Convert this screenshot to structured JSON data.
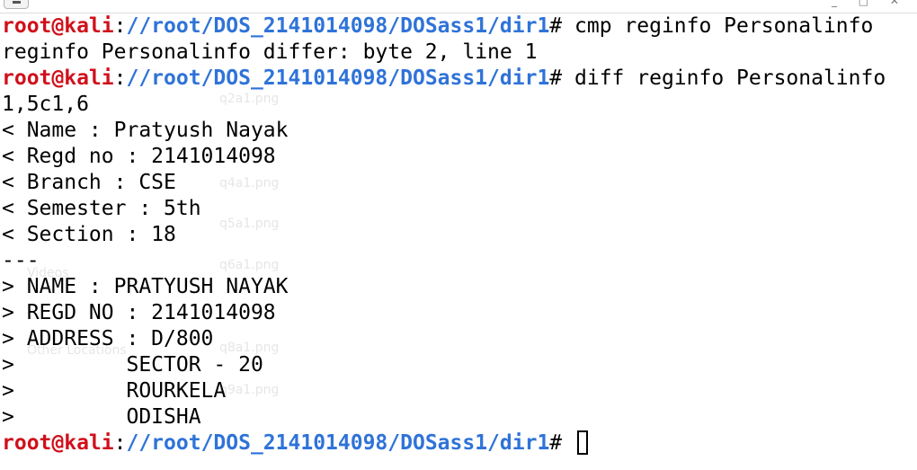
{
  "terminal": {
    "prompt": {
      "user": "root@kali",
      "separator": ":",
      "path": "//root/DOS_2141014098/DOSass1/dir1",
      "symbol": "#"
    },
    "lines": [
      {
        "type": "prompt",
        "command": "cmp reginfo Personalinfo"
      },
      {
        "type": "output",
        "text": "reginfo Personalinfo differ: byte 2, line 1"
      },
      {
        "type": "prompt",
        "command": "diff reginfo Personalinfo"
      },
      {
        "type": "output",
        "text": "1,5c1,6"
      },
      {
        "type": "output",
        "text": "< Name : Pratyush Nayak"
      },
      {
        "type": "output",
        "text": "< Regd no : 2141014098"
      },
      {
        "type": "output",
        "text": "< Branch : CSE"
      },
      {
        "type": "output",
        "text": "< Semester : 5th"
      },
      {
        "type": "output",
        "text": "< Section : 18"
      },
      {
        "type": "output",
        "text": "---"
      },
      {
        "type": "output",
        "text": "> NAME : PRATYUSH NAYAK"
      },
      {
        "type": "output",
        "text": "> REGD NO : 2141014098"
      },
      {
        "type": "output",
        "text": "> ADDRESS : D/800"
      },
      {
        "type": "output",
        "text": ">         SECTOR - 20"
      },
      {
        "type": "output",
        "text": ">         ROURKELA"
      },
      {
        "type": "output",
        "text": ">         ODISHA"
      },
      {
        "type": "prompt",
        "command": ""
      }
    ]
  },
  "background_files": [
    "q2a1.png",
    "q4a1.png",
    "q5a1.png",
    "q6a1.png",
    "q8a1.png",
    "q9a1.png",
    "Videos",
    "Other Locations"
  ]
}
